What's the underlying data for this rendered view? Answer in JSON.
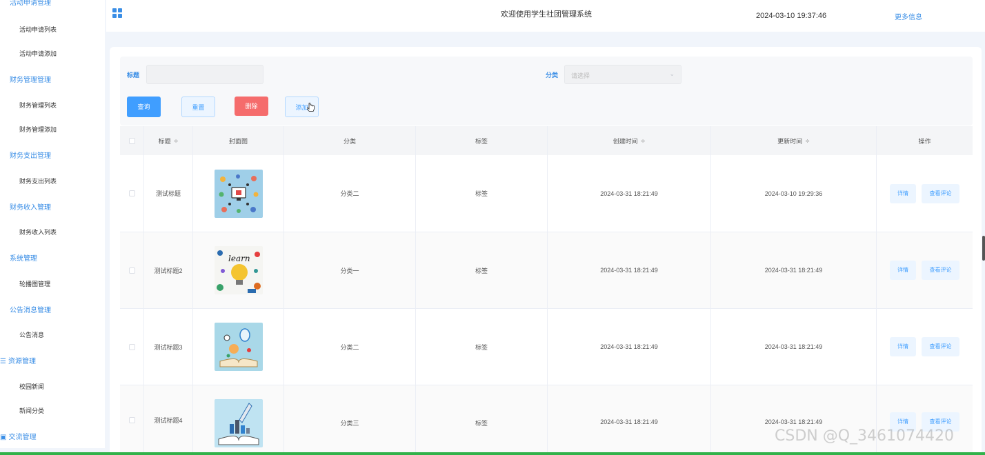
{
  "sidebar": {
    "top_partial": "活动申请管理",
    "groups": [
      {
        "label": "财务管理管理"
      },
      {
        "label": "财务支出管理"
      },
      {
        "label": "财务收入管理"
      },
      {
        "label": "系统管理"
      },
      {
        "label": "公告消息管理"
      },
      {
        "label": "资源管理",
        "icon": "list-icon"
      },
      {
        "label": "交流管理",
        "icon": "chat-icon"
      }
    ],
    "items": [
      {
        "label": "活动申请列表"
      },
      {
        "label": "活动申请添加"
      },
      {
        "label": "财务管理列表"
      },
      {
        "label": "财务管理添加"
      },
      {
        "label": "财务支出列表"
      },
      {
        "label": "财务收入列表"
      },
      {
        "label": "轮播图管理"
      },
      {
        "label": "公告消息"
      },
      {
        "label": "校园新闻"
      },
      {
        "label": "新闻分类"
      }
    ]
  },
  "header": {
    "welcome": "欢迎使用学生社团管理系统",
    "datetime": "2024-03-10 19:37:46",
    "more_info": "更多信息"
  },
  "search": {
    "title_label": "标题",
    "title_value": "",
    "category_label": "分类",
    "category_placeholder": "请选择"
  },
  "buttons": {
    "query": "查询",
    "reset": "重置",
    "delete": "删除",
    "add": "添加"
  },
  "table": {
    "columns": [
      "标题",
      "封面图",
      "分类",
      "标签",
      "创建时间",
      "更新时间",
      "操作"
    ],
    "rows": [
      {
        "title": "测试标题",
        "category": "分类二",
        "tag": "标签",
        "created": "2024-03-31 18:21:49",
        "updated": "2024-03-10 19:29:36",
        "detail": "详情",
        "comments": "查看评论"
      },
      {
        "title": "测试标题2",
        "category": "分类一",
        "tag": "标签",
        "created": "2024-03-31 18:21:49",
        "updated": "2024-03-31 18:21:49",
        "detail": "详情",
        "comments": "查看评论"
      },
      {
        "title": "测试标题3",
        "category": "分类二",
        "tag": "标签",
        "created": "2024-03-31 18:21:49",
        "updated": "2024-03-31 18:21:49",
        "detail": "详情",
        "comments": "查看评论"
      },
      {
        "title": "测试标题4",
        "category": "分类三",
        "tag": "标签",
        "created": "2024-03-31 18:21:49",
        "updated": "2024-03-31 18:21:49",
        "detail": "详情",
        "comments": "查看评论"
      }
    ]
  },
  "watermark": "CSDN @Q_3461074420",
  "colors": {
    "accent": "#409eff",
    "danger": "#f56c6c",
    "page_bg": "#f1f5fb"
  }
}
